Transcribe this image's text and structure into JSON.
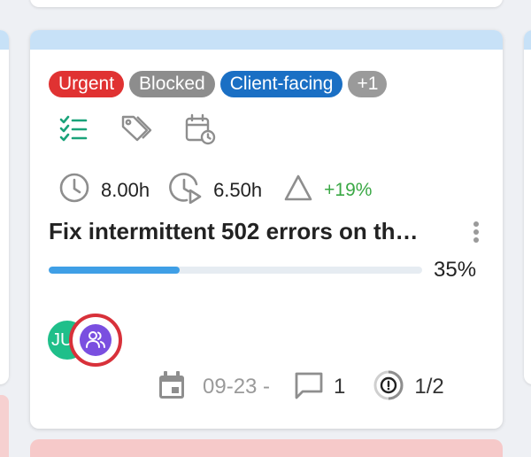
{
  "card": {
    "tags": [
      {
        "label": "Urgent",
        "color": "#e03232"
      },
      {
        "label": "Blocked",
        "color": "#8d8d8d"
      },
      {
        "label": "Client-facing",
        "color": "#1a6fc4"
      },
      {
        "label": "+1",
        "color": "#9a9a9a"
      }
    ],
    "icons": [
      "checklist-icon",
      "tags-icon",
      "calendar-clock-icon"
    ],
    "estimated": "8.00h",
    "spent": "6.50h",
    "variance": "+19%",
    "title": "Fix intermittent 502 errors on th…",
    "progress": {
      "value": 35,
      "label": "35%"
    },
    "avatars": [
      {
        "text": "JU",
        "color": "#1fbf8a"
      },
      {
        "icon": "users-icon",
        "color": "#7a4fe0",
        "highlight": "#d8313a"
      }
    ],
    "footer": {
      "date": "09-23 -",
      "comments": "1",
      "checklist": "1/2"
    }
  },
  "colors": {
    "accent_strip": "#c7e1f7",
    "progress": "#3f9fe6",
    "positive": "#3aa845"
  }
}
